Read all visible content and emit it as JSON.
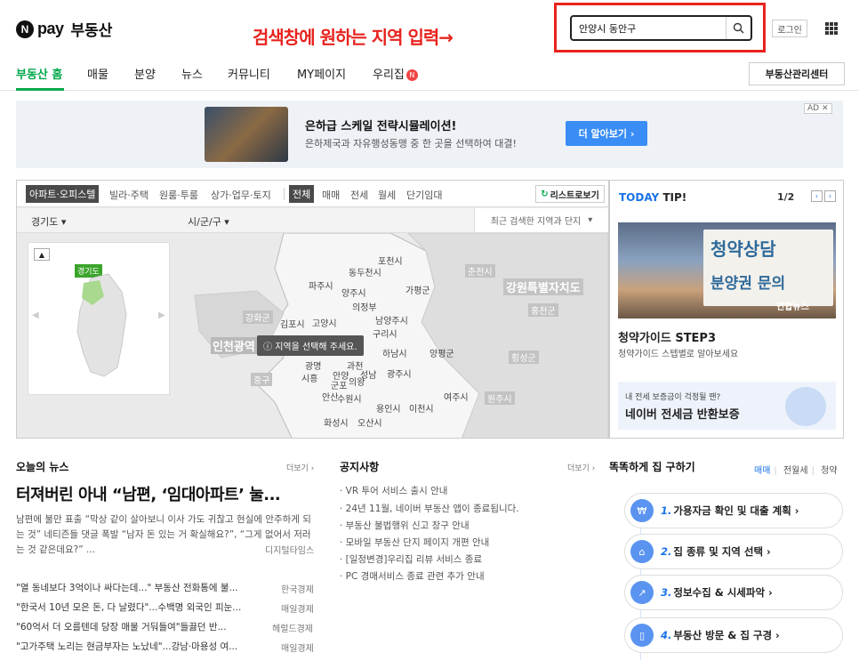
{
  "header": {
    "logo_n": "N",
    "logo_pay": "pay",
    "logo_text": "부동산",
    "annotation": "검색창에 원하는 지역 입력→",
    "search_value": "안양시 동안구",
    "login": "로그인"
  },
  "nav": {
    "items": [
      "부동산 홈",
      "매물",
      "분양",
      "뉴스",
      "커뮤니티",
      "MY페이지",
      "우리집"
    ],
    "badge": "N",
    "manager": "부동산관리센터"
  },
  "ad": {
    "title": "은하급 스케일 전략시뮬레이션!",
    "subtitle": "은하제국과 자유행성동맹 중 한 곳을 선택하여 대결!",
    "cta": "더 알아보기 ›",
    "adlabel": "AD ✕"
  },
  "map": {
    "type_tabs": [
      "아파트·오피스텔",
      "빌라·주택",
      "원룸·투룸",
      "상가·업무·토지"
    ],
    "deal_tabs": [
      "전체",
      "매매",
      "전세",
      "월세",
      "단기임대"
    ],
    "list_view": "리스트로보기",
    "province": "경기도",
    "city": "시/군/구",
    "recent": "최근 검색한 지역과 단지",
    "mini_badge": "경기도",
    "tooltip": "지역을 선택해 주세요.",
    "labels": [
      "포천시",
      "동두천시",
      "파주시",
      "양주시",
      "가평군",
      "의정부",
      "김포시",
      "고양시",
      "남양주시",
      "구리시",
      "인천광역",
      "하남시",
      "양평군",
      "광명",
      "과천",
      "성남",
      "광주시",
      "시흥",
      "안양",
      "군포",
      "의왕",
      "안산",
      "수원시",
      "용인시",
      "이천시",
      "여주시",
      "화성시",
      "오산시"
    ],
    "region_labels": [
      "춘천시",
      "강원특별자치도",
      "홍천군",
      "강화군",
      "횡성군",
      "원주시",
      "중구"
    ]
  },
  "tip": {
    "header_today": "TODAY",
    "header_tip": " TIP!",
    "page": "1/2",
    "prev": "‹",
    "next": "›",
    "sign1": "청약상담",
    "sign2": "분양권 문의",
    "watermark": "연합뉴스",
    "title": "청약가이드 STEP3",
    "desc": "청약가이드 스텝별로 알아보세요",
    "banner_sub": "내 전세 보증금이 걱정될 땐?",
    "banner_title": "네이버 전세금 반환보증"
  },
  "news": {
    "section": "오늘의 뉴스",
    "more": "더보기 ›",
    "headline": "터져버린 아내 “남편, ‘임대아파트’ 눌...",
    "summary": "남편에 불만 표출 “막상 같이 살아보니 이사 가도 귀찮고 현실에 안주하게 되는 것” 네티즌들 댓글 폭발 “남자 돈 있는 거 확실해요?”, “그게 없어서 저러는 것 같은데요?” ...",
    "summary_src": "디지털타임스",
    "items": [
      {
        "title": "\"열 동네보다 3억이나 싸다는데...\" 부동산 전화통에 불...",
        "src": "한국경제"
      },
      {
        "title": "\"한국서 10년 모은 돈, 다 날렸다\"...수백명 외국인 피눈...",
        "src": "매일경제"
      },
      {
        "title": "\"60억서 더 오를텐데 당장 매물 거둬들여\"들끓던 반...",
        "src": "헤럴드경제"
      },
      {
        "title": "\"고가주택 노리는 현금부자는 노났네\"...강남·마용성 여...",
        "src": "매일경제"
      }
    ]
  },
  "notice": {
    "section": "공지사항",
    "more": "더보기 ›",
    "items": [
      "· VR 투어 서비스 출시 안내",
      "· 24년 11월, 네이버 부동산 앱이 종료됩니다.",
      "· 부동산 불법행위 신고 창구 안내",
      "· 모바일 부동산 단지 페이지 개편 안내",
      "· [일정변경]우리집 리뷰 서비스 종료",
      "· PC 경매서비스 종료 관련 추가 안내"
    ]
  },
  "guide": {
    "section": "똑똑하게 집 구하기",
    "tabs": [
      "매매",
      "전월세",
      "청약"
    ],
    "steps": [
      {
        "num": "1.",
        "label": "가용자금 확인 및 대출 계획 ›",
        "icon": "₩"
      },
      {
        "num": "2.",
        "label": "집 종류 및 지역 선택 ›",
        "icon": "⌂"
      },
      {
        "num": "3.",
        "label": "정보수집 & 시세파악 ›",
        "icon": "↗"
      },
      {
        "num": "4.",
        "label": "부동산 방문 & 집 구경 ›",
        "icon": "▯"
      }
    ]
  }
}
